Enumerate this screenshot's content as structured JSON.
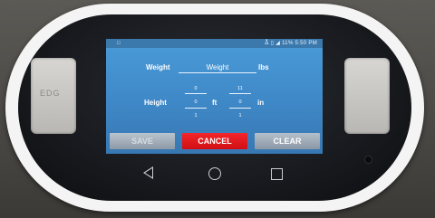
{
  "status_bar": {
    "left_icon": "notification-icon",
    "right_icons": [
      "bluetooth-icon",
      "vibrate-icon",
      "signal-icon"
    ],
    "battery": "11%",
    "time": "5:50 PM"
  },
  "form": {
    "weight_label": "Weight",
    "weight_placeholder": "Weight",
    "weight_unit": "lbs",
    "height_label": "Height",
    "feet": {
      "above": "0",
      "value": "0",
      "below": "1",
      "unit": "ft"
    },
    "inches": {
      "above": "11",
      "value": "0",
      "below": "1",
      "unit": "in"
    }
  },
  "buttons": {
    "save": "SAVE",
    "cancel": "CANCEL",
    "clear": "CLEAR"
  },
  "device": {
    "logo_text": "EDG",
    "nav": [
      "back-icon",
      "home-icon",
      "recent-apps-icon"
    ]
  },
  "colors": {
    "screen_bg": "#4290cf",
    "cancel": "#e81a20",
    "button_gray": "#9aa6b2"
  }
}
